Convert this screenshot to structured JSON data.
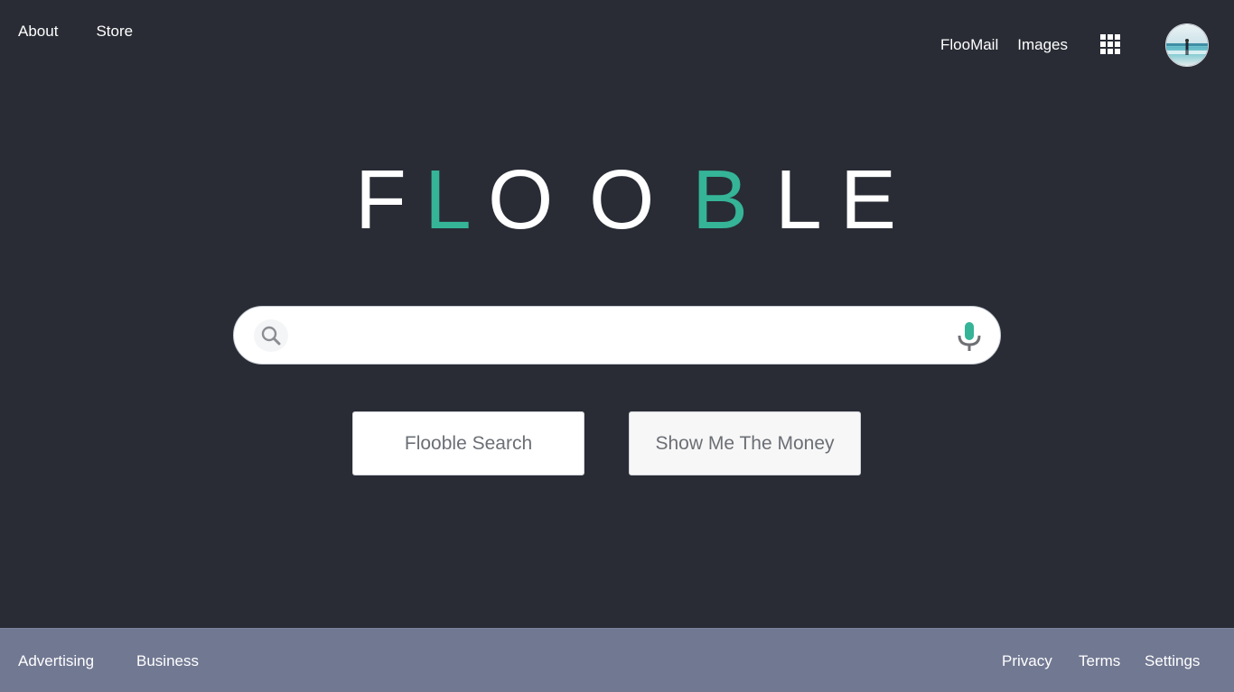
{
  "nav_left": {
    "about_label": "About",
    "store_label": "Store"
  },
  "nav_right": {
    "mail_label": "FlooMail",
    "images_label": "Images",
    "apps_icon": "grid-icon",
    "avatar_icon": "user-avatar"
  },
  "logo": {
    "letters": [
      "F",
      "L",
      "O",
      "O",
      "B",
      "L",
      "E"
    ],
    "colors": [
      "#ffffff",
      "#35b498",
      "#ffffff",
      "#ffffff",
      "#35b498",
      "#ffffff",
      "#ffffff"
    ]
  },
  "search": {
    "value": "",
    "placeholder": "",
    "search_icon": "search-icon",
    "mic_icon": "microphone-icon"
  },
  "buttons": {
    "search_label": "Flooble Search",
    "money_label": "Show Me The Money"
  },
  "footer": {
    "advertising_label": "Advertising",
    "business_label": "Business",
    "privacy_label": "Privacy",
    "terms_label": "Terms",
    "settings_label": "Settings"
  },
  "colors": {
    "background": "#292c35",
    "accent": "#35b498",
    "footer": "#717892"
  }
}
